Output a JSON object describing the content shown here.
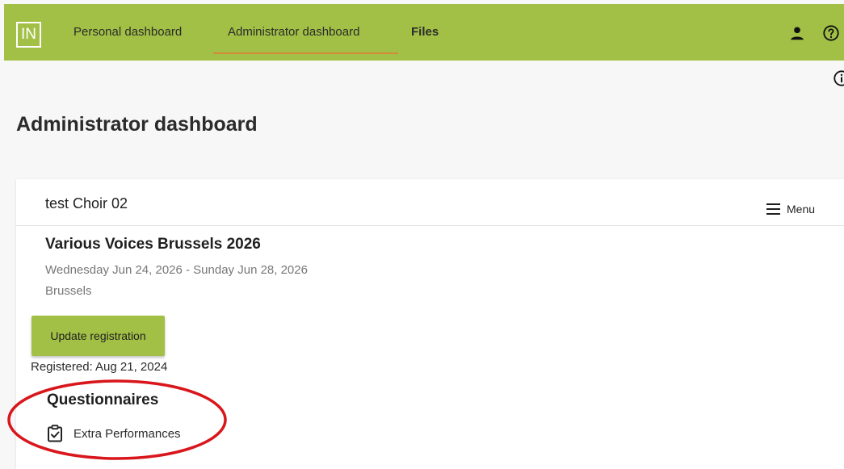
{
  "app": {
    "logo_text": "IN"
  },
  "nav": {
    "items": [
      {
        "label": "Personal dashboard"
      },
      {
        "label": "Administrator dashboard"
      },
      {
        "label": "Files"
      }
    ]
  },
  "header_icons": [
    "person-icon",
    "help-icon",
    "info-icon"
  ],
  "page": {
    "title": "Administrator dashboard"
  },
  "card": {
    "choir_name": "test Choir 02",
    "menu_label": "Menu",
    "event": {
      "title": "Various Voices Brussels 2026",
      "dates": "Wednesday Jun 24, 2026 - Sunday Jun 28, 2026",
      "city": "Brussels"
    },
    "update_button": "Update registration",
    "registered": "Registered: Aug 21, 2024",
    "questionnaires": {
      "title": "Questionnaires",
      "items": [
        {
          "label": "Extra Performances",
          "icon": "clipboard-check-icon"
        }
      ]
    }
  },
  "colors": {
    "accent": "#a2c046",
    "active_underline": "#d58a3a",
    "annotation": "#d9161b"
  }
}
